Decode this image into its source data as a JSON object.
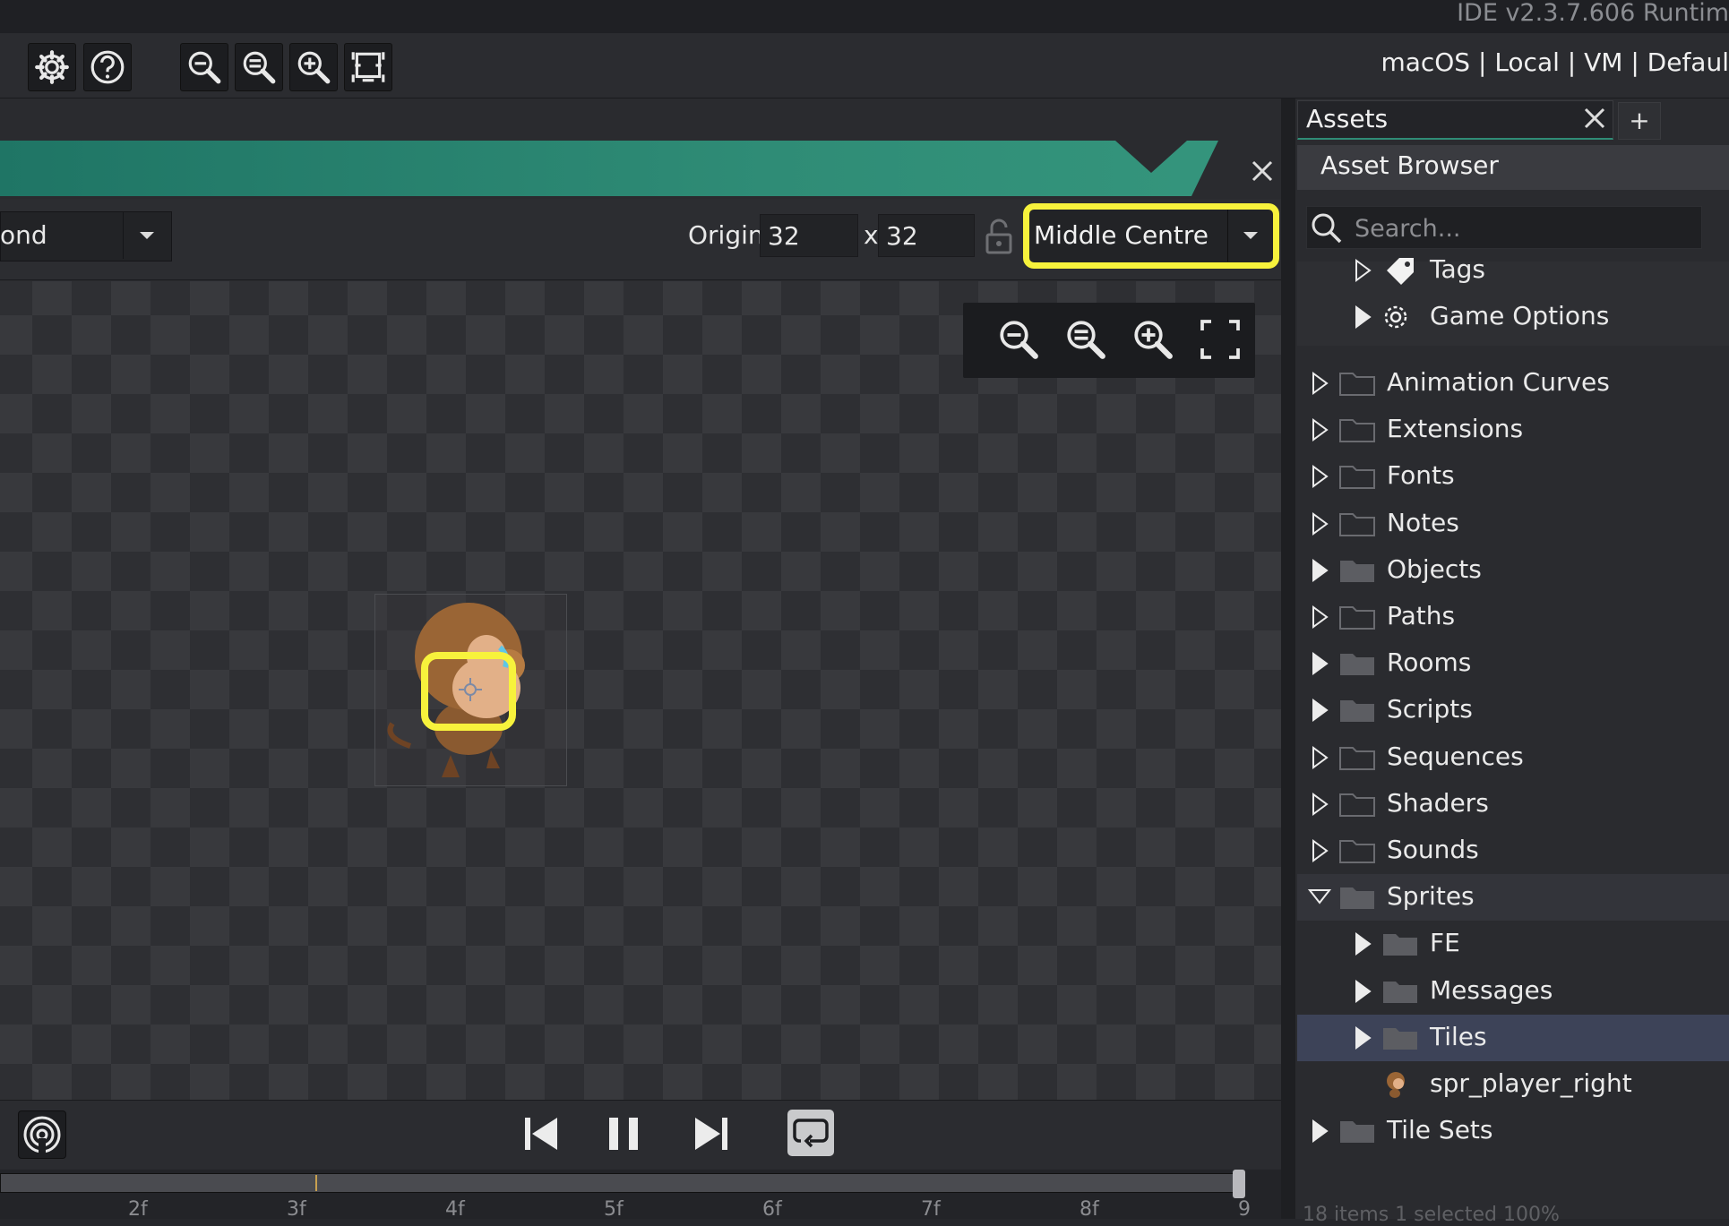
{
  "titlebar": {
    "text": "IDE v2.3.7.606  Runtim"
  },
  "toolbar": {
    "target": "macOS | Local | VM | Defaul",
    "buttons": [
      "gear-icon",
      "help-icon",
      "zoom-out-icon",
      "zoom-reset-icon",
      "zoom-in-icon",
      "fit-screen-icon"
    ]
  },
  "editor": {
    "left_dropdown_value": "ond",
    "origin_label": "Origin",
    "origin_x": "32",
    "x_separator": "x",
    "origin_y": "32",
    "origin_preset": "Middle Centre",
    "highlight_color": "#f7f23c",
    "header_color": "#2f8c76"
  },
  "playback": {
    "buttons": [
      "onion-skin-icon",
      "skip-start-icon",
      "pause-icon",
      "skip-end-icon",
      "loop-icon"
    ],
    "frame_labels": [
      "2f",
      "3f",
      "4f",
      "5f",
      "6f",
      "7f",
      "8f",
      "9"
    ]
  },
  "assets": {
    "tab_label": "Assets",
    "add_tab": "+",
    "browser_title": "Asset Browser",
    "search_placeholder": "Search...",
    "tree": [
      {
        "label": "Tags",
        "icon": "tag-icon",
        "level": 1,
        "expanded": false
      },
      {
        "label": "Game Options",
        "icon": "gear-icon",
        "level": 1,
        "expanded": false
      },
      {
        "label": "Animation Curves",
        "icon": "folder-icon",
        "level": 0,
        "expanded": false
      },
      {
        "label": "Extensions",
        "icon": "folder-icon",
        "level": 0,
        "expanded": false
      },
      {
        "label": "Fonts",
        "icon": "folder-icon",
        "level": 0,
        "expanded": false
      },
      {
        "label": "Notes",
        "icon": "folder-icon",
        "level": 0,
        "expanded": false
      },
      {
        "label": "Objects",
        "icon": "folder-icon",
        "level": 0,
        "expanded": false
      },
      {
        "label": "Paths",
        "icon": "folder-icon",
        "level": 0,
        "expanded": false
      },
      {
        "label": "Rooms",
        "icon": "folder-icon",
        "level": 0,
        "expanded": false
      },
      {
        "label": "Scripts",
        "icon": "folder-icon",
        "level": 0,
        "expanded": false
      },
      {
        "label": "Sequences",
        "icon": "folder-icon",
        "level": 0,
        "expanded": false
      },
      {
        "label": "Shaders",
        "icon": "folder-icon",
        "level": 0,
        "expanded": false
      },
      {
        "label": "Sounds",
        "icon": "folder-icon",
        "level": 0,
        "expanded": false
      },
      {
        "label": "Sprites",
        "icon": "folder-open-icon",
        "level": 0,
        "expanded": true
      },
      {
        "label": "FE",
        "icon": "folder-icon",
        "level": 1,
        "expanded": false
      },
      {
        "label": "Messages",
        "icon": "folder-icon",
        "level": 1,
        "expanded": false
      },
      {
        "label": "Tiles",
        "icon": "folder-icon",
        "level": 1,
        "expanded": false,
        "selected": true
      },
      {
        "label": "spr_player_right",
        "icon": "sprite-icon",
        "level": 1
      },
      {
        "label": "Tile Sets",
        "icon": "folder-icon",
        "level": 0,
        "expanded": false
      }
    ],
    "status": "18 items    1 selected              100%"
  }
}
